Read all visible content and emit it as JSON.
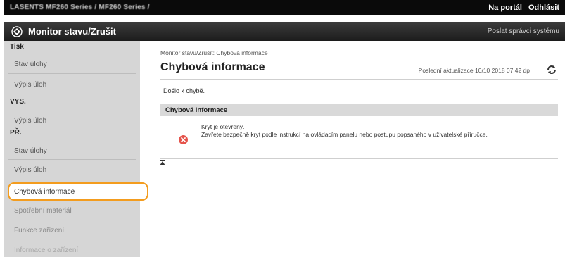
{
  "top_bar": {
    "model_text": "LASENTS    MF260 Series / MF260 Series /",
    "portal_link": "Na portál",
    "logout_link": "Odhlásit"
  },
  "title_bar": {
    "title": "Monitor stavu/Zrušit",
    "admin_link": "Poslat správci systému"
  },
  "sidebar": {
    "sections": [
      {
        "heading": "Tisk",
        "items": [
          "Stav úlohy",
          "Výpis úloh"
        ]
      },
      {
        "heading": "VYS.",
        "items": [
          "Výpis úloh"
        ]
      },
      {
        "heading": "PŘ.",
        "items": [
          "Stav úlohy",
          "Výpis úloh"
        ]
      }
    ],
    "selected_item": "Chybová informace",
    "other_items": [
      "Spotřební materiál",
      "Funkce zařízení",
      "Informace o zařízení"
    ]
  },
  "main": {
    "breadcrumb": "Monitor stavu/Zrušit: Chybová informace",
    "page_title": "Chybová informace",
    "last_update": "Poslední aktualizace 10/10 2018 07:42 dp",
    "error_message": "Došlo k chybě.",
    "panel_heading": "Chybová informace",
    "error_title": "Kryt je otevřený.",
    "error_detail": "Zavřete bezpečně kryt podle instrukcí na ovládacím panelu nebo postupu popsaného v uživatelské příručce."
  },
  "colors": {
    "highlight_border": "#f39c1e",
    "error_icon": "#e5534b",
    "sidebar_bg": "#d6d6d6"
  }
}
